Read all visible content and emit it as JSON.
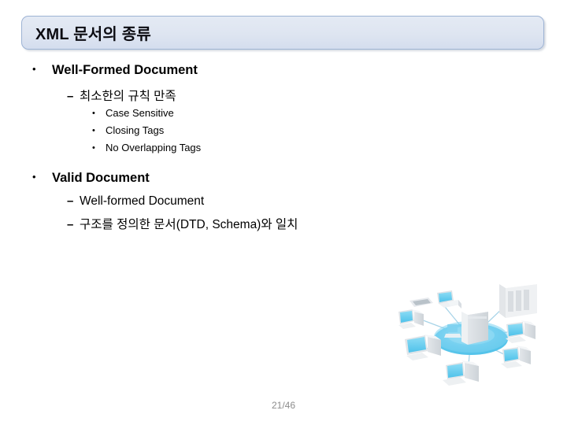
{
  "slide": {
    "title": "XML 문서의 종류",
    "page_number": "21/46",
    "background_color": "#ffffff",
    "title_bar": {
      "border_color": "#9db3d4",
      "fill_top_color": "#e4eaf4",
      "fill_bottom_color": "#d4ddee",
      "text_color": "#0c0c12"
    }
  },
  "content": {
    "blocks": [
      {
        "heading": "Well-Formed Document",
        "heading_bullet": "•",
        "sub": [
          {
            "text": "최소한의 규칙 만족",
            "bullet": "–",
            "items": [
              {
                "text": "Case Sensitive",
                "bullet": "•"
              },
              {
                "text": "Closing Tags",
                "bullet": "•"
              },
              {
                "text": "No Overlapping Tags",
                "bullet": "•"
              }
            ]
          }
        ]
      },
      {
        "heading": "Valid Document",
        "heading_bullet": "•",
        "sub": [
          {
            "text": "Well-formed Document",
            "bullet": "–",
            "items": []
          },
          {
            "text": "구조를 정의한 문서(DTD, Schema)와 일치",
            "bullet": "–",
            "items": []
          }
        ]
      }
    ]
  },
  "graphic": {
    "name": "network-diagram",
    "description": "Central server hub on a cyan disc connected by light blue lines to surrounding computers, laptops and a server rack",
    "hub_color": "#5cc8ec",
    "hub_color_light": "#9ee0f5",
    "line_color": "#a8d4e8",
    "device_color": "#f4f6f8",
    "screen_color": "#67c9ee"
  }
}
